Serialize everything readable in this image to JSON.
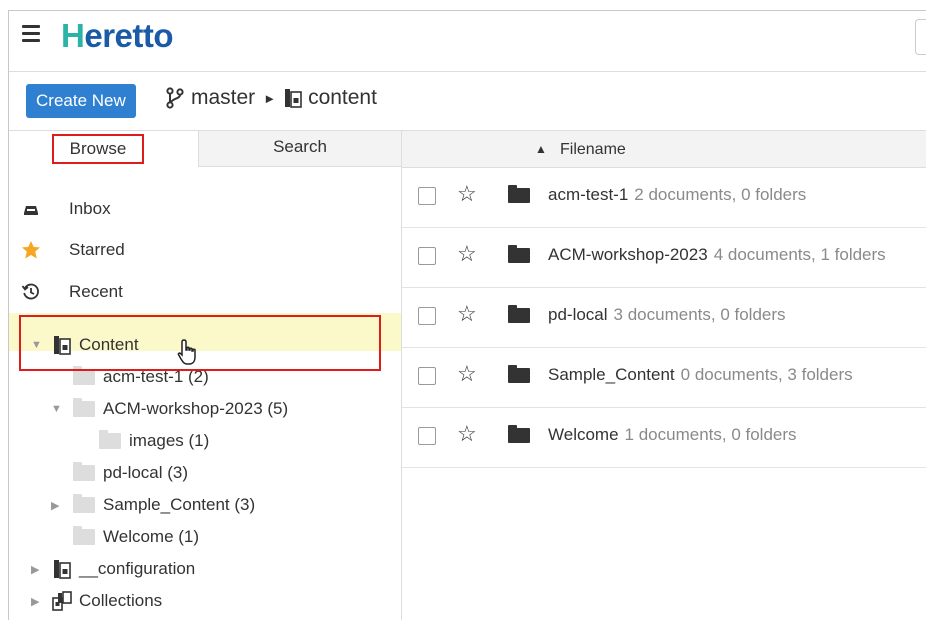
{
  "header": {
    "logo_first": "H",
    "logo_rest": "eretto"
  },
  "toolbar": {
    "create_label": "Create New",
    "branch": "master",
    "separator": "►",
    "location": "content"
  },
  "tabs": {
    "browse": "Browse",
    "search": "Search"
  },
  "nav": [
    {
      "label": "Inbox",
      "icon": "inbox-icon"
    },
    {
      "label": "Starred",
      "icon": "star-filled-icon"
    },
    {
      "label": "Recent",
      "icon": "recent-clock-icon"
    }
  ],
  "tree": {
    "root_label": "Content",
    "children": [
      {
        "label": "acm-test-1 (2)"
      },
      {
        "label": "ACM-workshop-2023 (5)"
      },
      {
        "label": "images (1)"
      },
      {
        "label": "pd-local (3)"
      },
      {
        "label": "Sample_Content (3)"
      },
      {
        "label": "Welcome (1)"
      }
    ],
    "configuration": "__configuration",
    "collections": "Collections"
  },
  "list": {
    "column_header": "Filename",
    "sort_indicator": "▲",
    "rows": [
      {
        "name": "acm-test-1",
        "meta": "2 documents, 0 folders"
      },
      {
        "name": "ACM-workshop-2023",
        "meta": "4 documents, 1 folders"
      },
      {
        "name": "pd-local",
        "meta": "3 documents, 0 folders"
      },
      {
        "name": "Sample_Content",
        "meta": "0 documents, 3 folders"
      },
      {
        "name": "Welcome",
        "meta": "1 documents, 0 folders"
      }
    ]
  },
  "colors": {
    "accent": "#2f80d1",
    "logo_blue": "#1a5aa6",
    "logo_teal": "#2bb3a7",
    "highlight": "#fbf8c9",
    "annotation_red": "#e01b1b",
    "star_gold": "#f5a623"
  }
}
